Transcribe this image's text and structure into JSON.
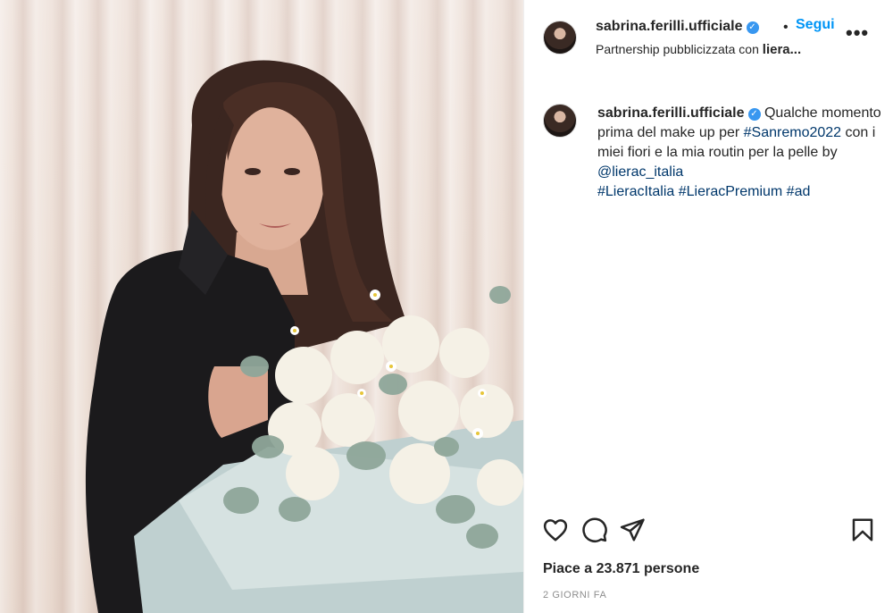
{
  "post": {
    "username": "sabrina.ferilli.ufficiale",
    "separator": "•",
    "follow_label": "Segui",
    "partnership_prefix": "Partnership pubblicizzata con ",
    "partnership_brand": "liera...",
    "more_label": "•••",
    "caption_text_1": " Qualche momento prima del make up per ",
    "caption_hashtag_1": "#Sanremo2022",
    "caption_text_2": " con i miei fiori e la mia routin per la pelle by ",
    "caption_mention": "@lierac_italia",
    "caption_hashtag_2": "#LieracItalia",
    "caption_hashtag_3": "#LieracPremium",
    "caption_hashtag_4": "#ad",
    "likes_label": "Piace a 23.871 persone",
    "timestamp": "2 GIORNI FA",
    "verified_mark": "✓"
  },
  "icons": {
    "like": "heart-icon",
    "comment": "comment-icon",
    "share": "paper-plane-icon",
    "save": "bookmark-icon"
  },
  "colors": {
    "follow": "#0095f6",
    "link": "#00376b",
    "verified": "#3897f0",
    "text": "#262626",
    "muted": "#8e8e8e"
  }
}
